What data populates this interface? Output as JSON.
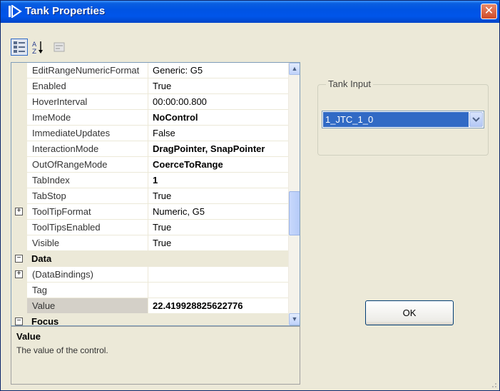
{
  "window": {
    "title": "Tank Properties",
    "close_glyph": "✕"
  },
  "toolbar": {
    "buttons": [
      {
        "icon": "categorized-icon",
        "active": true
      },
      {
        "icon": "alphabetical-sort-icon",
        "active": false
      },
      {
        "icon": "property-pages-icon",
        "active": false
      }
    ]
  },
  "property_grid": {
    "rows": [
      {
        "name": "EditRangeNumericFormat",
        "value": "Generic: G5",
        "bold": false
      },
      {
        "name": "Enabled",
        "value": "True",
        "bold": false
      },
      {
        "name": "HoverInterval",
        "value": "00:00:00.800",
        "bold": false
      },
      {
        "name": "ImeMode",
        "value": "NoControl",
        "bold": true
      },
      {
        "name": "ImmediateUpdates",
        "value": "False",
        "bold": false
      },
      {
        "name": "InteractionMode",
        "value": "DragPointer, SnapPointer",
        "bold": true
      },
      {
        "name": "OutOfRangeMode",
        "value": "CoerceToRange",
        "bold": true
      },
      {
        "name": "TabIndex",
        "value": "1",
        "bold": true
      },
      {
        "name": "TabStop",
        "value": "True",
        "bold": false
      },
      {
        "name": "ToolTipFormat",
        "value": "Numeric, G5",
        "bold": false,
        "expandable": true
      },
      {
        "name": "ToolTipsEnabled",
        "value": "True",
        "bold": false
      },
      {
        "name": "Visible",
        "value": "True",
        "bold": false
      },
      {
        "category": "Data"
      },
      {
        "name": "(DataBindings)",
        "value": "",
        "bold": false,
        "expandable": true
      },
      {
        "name": "Tag",
        "value": "",
        "bold": false
      },
      {
        "name": "Value",
        "value": "22.419928825622776",
        "bold": true,
        "selected": true
      },
      {
        "category": "Focus"
      }
    ]
  },
  "description": {
    "title": "Value",
    "text": "The value of the control."
  },
  "tank_input": {
    "group_label": "Tank Input",
    "selected_value": "1_JTC_1_0"
  },
  "ok_button": {
    "label": "OK"
  },
  "colors": {
    "title_bar": "#0054e3",
    "selection": "#316ac5",
    "dialog_bg": "#ece9d8"
  }
}
